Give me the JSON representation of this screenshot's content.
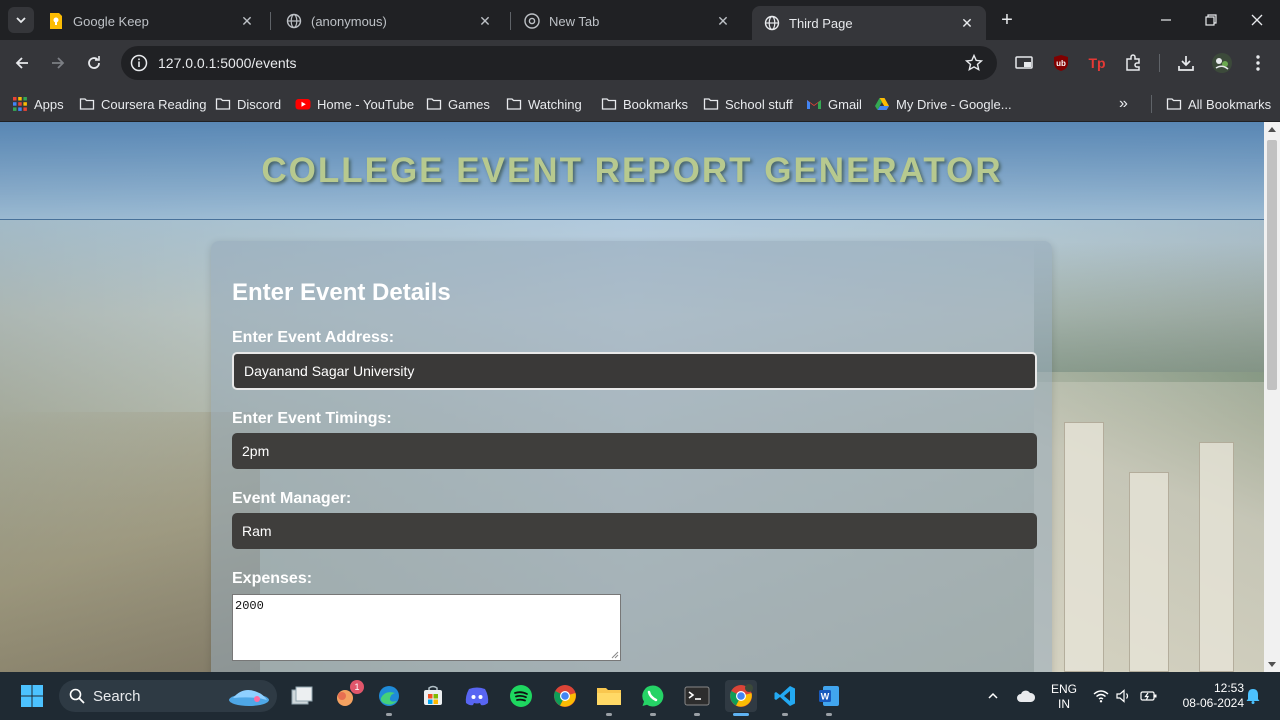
{
  "browser": {
    "tabs": [
      {
        "title": "Google Keep",
        "favicon": "keep-icon",
        "active": false
      },
      {
        "title": "(anonymous)",
        "favicon": "globe-icon",
        "active": false
      },
      {
        "title": "New Tab",
        "favicon": "chrome-icon",
        "active": false
      },
      {
        "title": "Third Page",
        "favicon": "globe-icon",
        "active": true
      }
    ],
    "url": "127.0.0.1:5000/events",
    "bookmarks": [
      {
        "label": "Apps",
        "icon": "apps-grid-icon"
      },
      {
        "label": "Coursera Reading",
        "icon": "folder-icon"
      },
      {
        "label": "Discord",
        "icon": "folder-icon"
      },
      {
        "label": "Home - YouTube",
        "icon": "youtube-icon"
      },
      {
        "label": "Games",
        "icon": "folder-icon"
      },
      {
        "label": "Watching",
        "icon": "folder-icon"
      },
      {
        "label": "Bookmarks",
        "icon": "folder-icon"
      },
      {
        "label": "School stuff",
        "icon": "folder-icon"
      },
      {
        "label": "Gmail",
        "icon": "gmail-icon"
      },
      {
        "label": "My Drive - Google...",
        "icon": "drive-icon"
      }
    ],
    "bookmarks_overflow": "»",
    "all_bookmarks": "All Bookmarks"
  },
  "page": {
    "header_title": "COLLEGE EVENT REPORT GENERATOR",
    "form": {
      "heading": "Enter Event Details",
      "address_label": "Enter Event Address:",
      "address_value": "Dayanand Sagar University",
      "timings_label": "Enter Event Timings:",
      "timings_value": "2pm",
      "manager_label": "Event Manager:",
      "manager_value": "Ram",
      "expenses_label": "Expenses:",
      "expenses_value": "2000"
    }
  },
  "taskbar": {
    "search_label": "Search",
    "notification_badge": "1",
    "language": "ENG",
    "region": "IN",
    "time": "12:53",
    "date": "08-06-2024"
  },
  "colors": {
    "header_title": "#b7c98f",
    "field_bg": "#3f3e3c",
    "browser_dark": "#202124",
    "toolbar": "#35363a"
  }
}
